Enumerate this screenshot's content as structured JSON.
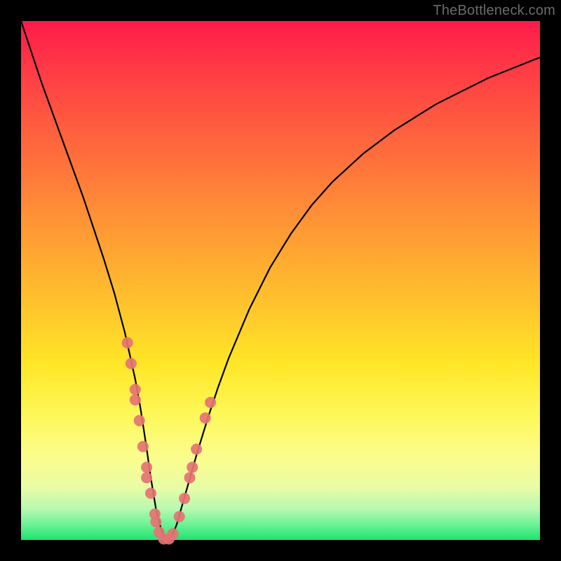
{
  "watermark": "TheBottleneck.com",
  "colors": {
    "frame": "#000000",
    "curve": "#000000",
    "dot": "#e57373",
    "gradient_top": "#ff1a4b",
    "gradient_bottom": "#1de46e"
  },
  "chart_data": {
    "type": "line",
    "title": "",
    "xlabel": "",
    "ylabel": "",
    "xlim": [
      0,
      100
    ],
    "ylim": [
      0,
      100
    ],
    "annotations": [
      "TheBottleneck.com"
    ],
    "series": [
      {
        "name": "bottleneck-curve",
        "x": [
          0,
          2,
          4,
          6,
          8,
          10,
          12,
          14,
          16,
          18,
          20,
          22,
          23,
          24,
          25,
          26,
          27,
          28,
          29,
          30,
          32,
          34,
          36,
          38,
          40,
          44,
          48,
          52,
          56,
          60,
          66,
          72,
          80,
          90,
          100
        ],
        "y": [
          100,
          94,
          88,
          82.5,
          77,
          71.5,
          66,
          60,
          54,
          47.5,
          40,
          31,
          25.5,
          19,
          12,
          6,
          2,
          0,
          0.5,
          3,
          10,
          17,
          23.5,
          29.5,
          35,
          44.5,
          52.5,
          59,
          64.5,
          69,
          74.5,
          79,
          84,
          89,
          93
        ]
      }
    ],
    "scatter_highlights": {
      "name": "highlight-dots",
      "points": [
        {
          "x": 20.5,
          "y": 38
        },
        {
          "x": 21.2,
          "y": 34
        },
        {
          "x": 22.0,
          "y": 29
        },
        {
          "x": 22.0,
          "y": 27
        },
        {
          "x": 22.8,
          "y": 23
        },
        {
          "x": 23.5,
          "y": 18
        },
        {
          "x": 24.2,
          "y": 14
        },
        {
          "x": 24.2,
          "y": 12
        },
        {
          "x": 25.0,
          "y": 9
        },
        {
          "x": 25.8,
          "y": 5
        },
        {
          "x": 26.0,
          "y": 3.5
        },
        {
          "x": 26.6,
          "y": 1.5
        },
        {
          "x": 27.5,
          "y": 0.2
        },
        {
          "x": 28.5,
          "y": 0.2
        },
        {
          "x": 29.3,
          "y": 1.2
        },
        {
          "x": 30.5,
          "y": 4.5
        },
        {
          "x": 31.5,
          "y": 8
        },
        {
          "x": 32.5,
          "y": 12
        },
        {
          "x": 33.0,
          "y": 14
        },
        {
          "x": 33.8,
          "y": 17.5
        },
        {
          "x": 35.5,
          "y": 23.5
        },
        {
          "x": 36.5,
          "y": 26.5
        }
      ]
    }
  }
}
